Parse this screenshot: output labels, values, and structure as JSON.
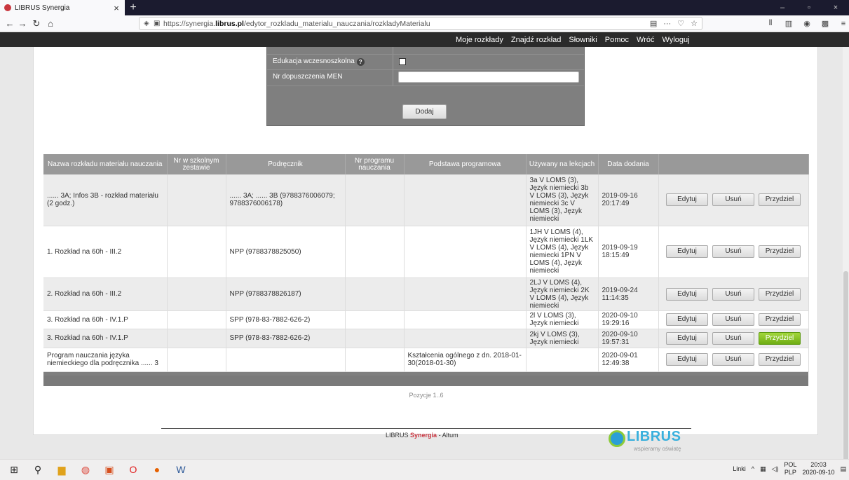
{
  "browser": {
    "tab_title": "LIBRUS Synergia",
    "tab_close": "×",
    "new_tab": "+",
    "url_prefix": "https://synergia.",
    "url_domain": "librus.pl",
    "url_path": "/edytor_rozkladu_materialu_nauczania/rozkladyMaterialu",
    "url_menu": "···",
    "win_minimize": "–",
    "win_maximize": "▫",
    "win_close": "×"
  },
  "top_menu": [
    "Moje rozkłady",
    "Znajdź rozkład",
    "Słowniki",
    "Pomoc",
    "Wróć",
    "Wyloguj"
  ],
  "form": {
    "label_edukacja": "Edukacja wczesnoszkolna",
    "help_glyph": "?",
    "label_men": "Nr dopuszczenia MEN",
    "men_value": "",
    "add_button": "Dodaj"
  },
  "table": {
    "headers": [
      "Nazwa rozkładu materiału nauczania",
      "Nr w szkolnym zestawie",
      "Podręcznik",
      "Nr programu nauczania",
      "Podstawa programowa",
      "Używany na lekcjach",
      "Data dodania",
      ""
    ],
    "rows": [
      {
        "name": "...... 3A; Infos 3B - rozkład materiału (2 godz.)",
        "nr": "",
        "book": "...... 3A; ...... 3B (9788376006079; 9788376006178)",
        "program": "",
        "podstawa": "",
        "lessons": "3a V LOMS (3), Język niemiecki 3b V LOMS (3), Język niemiecki 3c V LOMS (3), Język niemiecki",
        "date": "2019-09-16 20:17:49",
        "highlight": false
      },
      {
        "name": "1. Rozkład na 60h - III.2",
        "nr": "",
        "book": "NPP (9788378825050)",
        "program": "",
        "podstawa": "",
        "lessons": "1JH V LOMS (4), Język niemiecki 1LK V LOMS (4), Język niemiecki 1PN V LOMS (4), Język niemiecki",
        "date": "2019-09-19 18:15:49",
        "highlight": false
      },
      {
        "name": "2. Rozkład na 60h - III.2",
        "nr": "",
        "book": "NPP (9788378826187)",
        "program": "",
        "podstawa": "",
        "lessons": "2LJ V LOMS (4), Język niemiecki 2K V LOMS (4), Język niemiecki",
        "date": "2019-09-24 11:14:35",
        "highlight": false
      },
      {
        "name": "3. Rozkład na 60h - IV.1.P",
        "nr": "",
        "book": "SPP (978-83-7882-626-2)",
        "program": "",
        "podstawa": "",
        "lessons": "2l V LOMS (3), Język niemiecki",
        "date": "2020-09-10 19:29:16",
        "highlight": false
      },
      {
        "name": "3. Rozkład na 60h - IV.1.P",
        "nr": "",
        "book": "SPP (978-83-7882-626-2)",
        "program": "",
        "podstawa": "",
        "lessons": "2kj V LOMS (3), Język niemiecki",
        "date": "2020-09-10 19:57:31",
        "highlight": true
      },
      {
        "name": "Program nauczania języka niemieckiego dla podręcznika ...... 3",
        "nr": "",
        "book": "",
        "program": "",
        "podstawa": "Kształcenia ogólnego z dn. 2018-01-30(2018-01-30)",
        "lessons": "",
        "date": "2020-09-01 12:49:38",
        "highlight": false
      }
    ],
    "btn_edit": "Edytuj",
    "btn_delete": "Usuń",
    "btn_assign": "Przydziel"
  },
  "pagination": "Pozycje 1..6",
  "footer": {
    "brand": "LIBRUS",
    "product": "Synergia",
    "suffix": " - Altum",
    "logo_name": "LIBRUS",
    "logo_tagline": "wspieramy oświatę"
  },
  "taskbar": {
    "links": "Linki",
    "lang1": "POL",
    "lang2": "PLP",
    "time": "20:03",
    "date": "2020-09-10"
  },
  "colors": {
    "menu_bar": "#2b2b2b",
    "accent_green": "#8bc34a",
    "brand_red": "#c93540",
    "brand_blue": "#39b0dd"
  }
}
